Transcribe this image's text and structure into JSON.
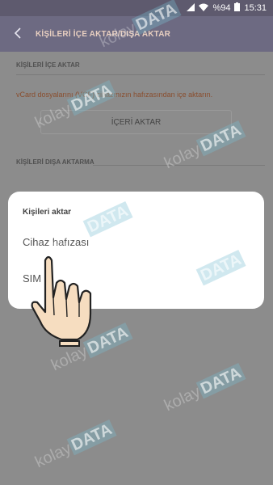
{
  "status_bar": {
    "battery": "%94",
    "time": "15:31"
  },
  "app_bar": {
    "title": "KİŞİLERİ İÇE AKTAR/DIŞA AKTAR"
  },
  "import_section": {
    "header": "KİŞİLERİ İÇE AKTAR",
    "description": "vCard dosyalarını (VCF) cihazınızın hafızasından içe aktarın.",
    "button_label": "İÇERİ AKTAR"
  },
  "export_section": {
    "header": "KİŞİLERİ DIŞA AKTARMA"
  },
  "dialog": {
    "title": "Kişileri aktar",
    "options": [
      "Cihaz hafızası",
      "SIM"
    ]
  },
  "watermark": {
    "part1": "kolay",
    "part2": "DATA"
  },
  "colors": {
    "app_bar": "#6d6a82",
    "title_text": "#e8cfc0",
    "dim_overlay": "#8c8c8c"
  },
  "icons": [
    "back-arrow-icon",
    "battery-icon",
    "wifi-icon",
    "signal-icon",
    "pointing-hand-icon"
  ]
}
